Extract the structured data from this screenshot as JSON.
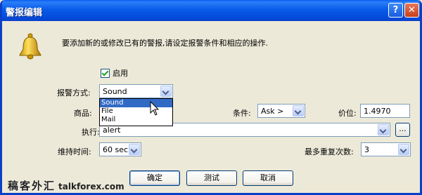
{
  "window": {
    "title": "警报编辑"
  },
  "titlebar_buttons": {
    "help": "?",
    "close": "✕"
  },
  "message": "要添加新的或修改已有的警报,请设定报警条件和相应的操作.",
  "enable": {
    "label": "启用",
    "checked": true
  },
  "alert_method": {
    "label": "报警方式:",
    "value": "Sound",
    "options": [
      "Sound",
      "File",
      "Mail"
    ],
    "highlighted": "Sound"
  },
  "symbol": {
    "label": "商品:"
  },
  "condition": {
    "label": "条件:",
    "value": "Ask >"
  },
  "price": {
    "label": "价位:",
    "value": "1.4970"
  },
  "action": {
    "label": "执行:",
    "value": "alert",
    "browse_label": "..."
  },
  "timeout": {
    "label": "维持时间:",
    "value": "60 sec"
  },
  "max_repeats": {
    "label": "最多重复次数:",
    "value": "3"
  },
  "buttons": {
    "ok": "确定",
    "test": "测试",
    "cancel": "取消"
  },
  "watermark": {
    "cn": "稿客外汇",
    "en": "talkforex.com"
  }
}
